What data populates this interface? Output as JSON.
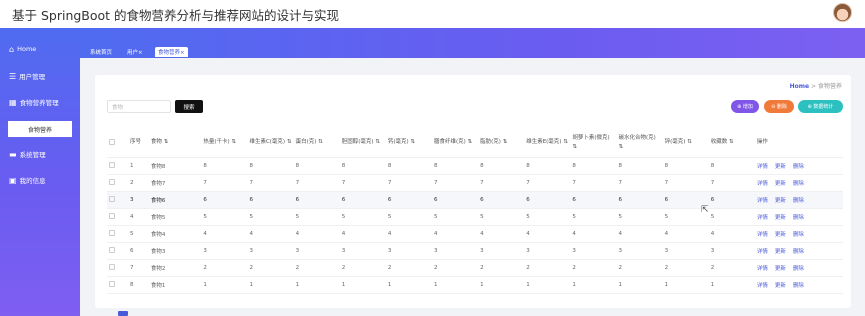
{
  "app": {
    "title": "基于 SpringBoot 的食物营养分析与推荐网站的设计与实现"
  },
  "sidebar": {
    "items": [
      {
        "icon": "home-icon",
        "label": "Home"
      },
      {
        "icon": "menu-icon",
        "label": "用户管理"
      },
      {
        "icon": "grid-icon",
        "label": "食物营养管理"
      },
      {
        "icon": "card-icon",
        "label": "系统管理"
      },
      {
        "icon": "profile-icon",
        "label": "我的信息"
      }
    ],
    "sub_item": "食物营养"
  },
  "tabs": [
    {
      "label": "系统首页"
    },
    {
      "label": "用户×"
    },
    {
      "label": "食物营养×"
    }
  ],
  "breadcrumb": {
    "home": "Home",
    "separator": ">",
    "current": "食物营养"
  },
  "search": {
    "placeholder": "食物",
    "button": "搜索"
  },
  "actions": {
    "add": "⊕ 增加",
    "delete": "⊖ 删除",
    "stats": "⊕ 数据统计"
  },
  "table": {
    "headers": [
      "",
      "序号",
      "食物 ⇅",
      "热量(千卡) ⇅",
      "维生素C(毫克) ⇅",
      "蛋白(克) ⇅",
      "胆固醇(毫克) ⇅",
      "钙(毫克) ⇅",
      "膳食纤维(克) ⇅",
      "脂肪(克) ⇅",
      "维生素E(毫克) ⇅",
      "胡萝卜素(微克) ⇅",
      "碳水化合物(克) ⇅",
      "锌(毫克) ⇅",
      "收藏数 ⇅",
      "操作"
    ],
    "rows": [
      {
        "index": "1",
        "food": "食物8",
        "v": [
          "8",
          "8",
          "8",
          "8",
          "8",
          "8",
          "8",
          "8",
          "8",
          "8",
          "8",
          "8"
        ]
      },
      {
        "index": "2",
        "food": "食物7",
        "v": [
          "7",
          "7",
          "7",
          "7",
          "7",
          "7",
          "7",
          "7",
          "7",
          "7",
          "7",
          "7"
        ]
      },
      {
        "index": "3",
        "food": "食物6",
        "v": [
          "6",
          "6",
          "6",
          "6",
          "6",
          "6",
          "6",
          "6",
          "6",
          "6",
          "6",
          "6"
        ]
      },
      {
        "index": "4",
        "food": "食物5",
        "v": [
          "5",
          "5",
          "5",
          "5",
          "5",
          "5",
          "5",
          "5",
          "5",
          "5",
          "5",
          "5"
        ]
      },
      {
        "index": "5",
        "food": "食物4",
        "v": [
          "4",
          "4",
          "4",
          "4",
          "4",
          "4",
          "4",
          "4",
          "4",
          "4",
          "4",
          "4"
        ]
      },
      {
        "index": "6",
        "food": "食物3",
        "v": [
          "3",
          "3",
          "3",
          "3",
          "3",
          "3",
          "3",
          "3",
          "3",
          "3",
          "3",
          "3"
        ]
      },
      {
        "index": "7",
        "food": "食物2",
        "v": [
          "2",
          "2",
          "2",
          "2",
          "2",
          "2",
          "2",
          "2",
          "2",
          "2",
          "2",
          "2"
        ]
      },
      {
        "index": "8",
        "food": "食物1",
        "v": [
          "1",
          "1",
          "1",
          "1",
          "1",
          "1",
          "1",
          "1",
          "1",
          "1",
          "1",
          "1"
        ]
      }
    ],
    "ops": {
      "detail": "详情",
      "edit": "更新",
      "delete": "删除"
    },
    "highlight_row": 3
  },
  "colors": {
    "accent": "#4a5bd8",
    "sidebar_top": "#4f6bf0",
    "sidebar_bottom": "#7f5ef2",
    "btn_add": "#7f56e8",
    "btn_del": "#f07a3a",
    "btn_stat": "#2cc0c0"
  }
}
